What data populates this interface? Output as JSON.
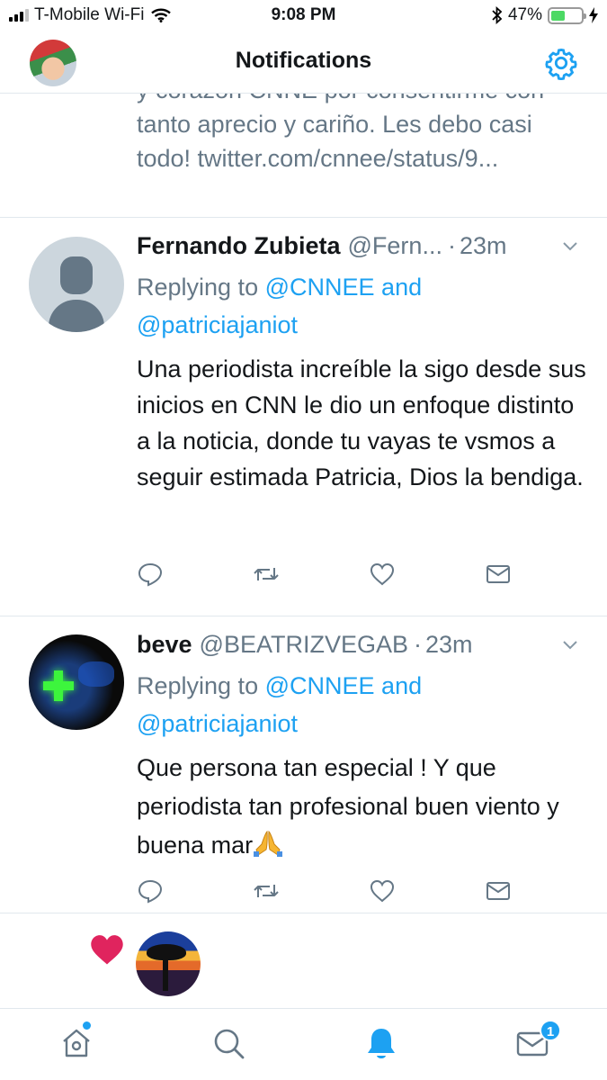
{
  "status_bar": {
    "carrier": "T-Mobile Wi-Fi",
    "time": "9:08 PM",
    "battery_percent": "47%",
    "battery_level": 0.47,
    "icons": [
      "signal-icon",
      "wifi-icon",
      "bluetooth-icon",
      "battery-icon",
      "charging-icon"
    ]
  },
  "header": {
    "title": "Notifications",
    "settings_icon": "gear-icon"
  },
  "partial_tweet": {
    "text": "y corazon CNNE por consentirme con tanto aprecio y cariño. Les debo casi todo! twitter.com/cnnee/status/9..."
  },
  "tweets": [
    {
      "name": "Fernando Zubieta",
      "handle": "@Fern...",
      "dot": "·",
      "time": "23m",
      "reply_prefix": "Replying to",
      "reply_mention_1": "@CNNEE",
      "reply_and": "and",
      "reply_mention_2": "@patriciajaniot",
      "text": "Una periodista increíble la sigo desde sus inicios en CNN le dio un enfoque distinto a la noticia, donde tu vayas te vsmos a seguir estimada Patricia, Dios la bendiga."
    },
    {
      "name": "beve",
      "handle": "@BEATRIZVEGAB",
      "dot": "·",
      "time": "23m",
      "reply_prefix": "Replying to",
      "reply_mention_1": "@CNNEE",
      "reply_and": "and",
      "reply_mention_2": "@patriciajaniot",
      "text": "Que persona tan especial ! Y que periodista tan profesional buen viento y buena mar",
      "emoji": "pray-emoji"
    }
  ],
  "tweet_actions": [
    "reply-icon",
    "retweet-icon",
    "like-icon",
    "direct-message-icon"
  ],
  "like_notification": {
    "icon": "heart-icon",
    "color": "#e0245e"
  },
  "tab_bar": {
    "items": [
      "home-icon",
      "search-icon",
      "notifications-icon",
      "messages-icon"
    ],
    "active": "notifications-icon",
    "messages_badge": "1"
  },
  "colors": {
    "accent": "#1da1f2",
    "secondary_text": "#657786",
    "primary_text": "#14171a",
    "like": "#e0245e"
  }
}
